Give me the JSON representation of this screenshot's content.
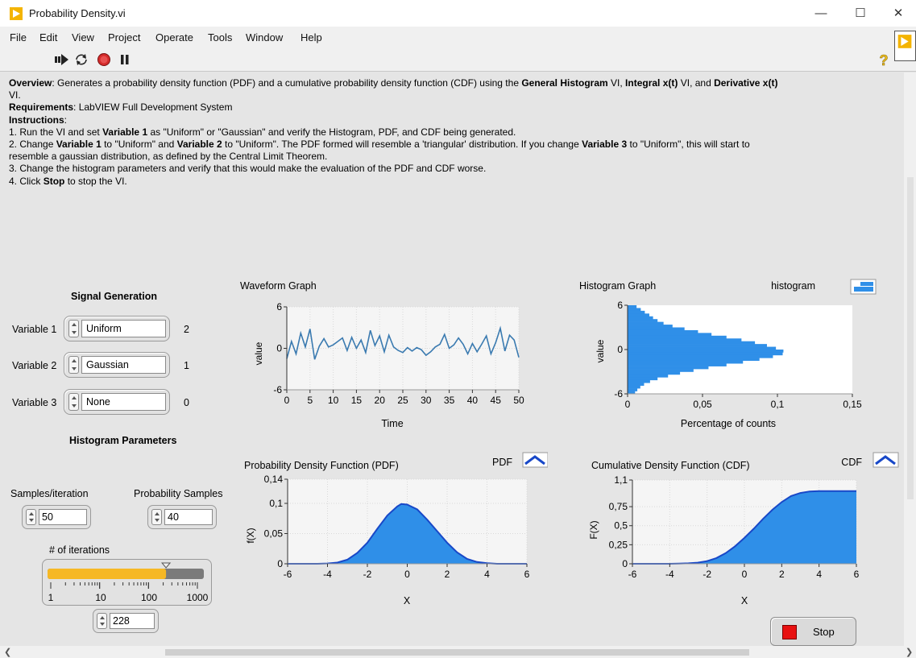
{
  "window": {
    "title": "Probability Density.vi",
    "controls": {
      "minimize": "—",
      "maximize": "☐",
      "close": "✕"
    }
  },
  "menu": [
    "File",
    "Edit",
    "View",
    "Project",
    "Operate",
    "Tools",
    "Window",
    "Help"
  ],
  "toolbar": {
    "icons": [
      "run-arrow-icon",
      "run-continuously-icon",
      "abort-execution-icon",
      "pause-icon"
    ],
    "help_glyph": "?"
  },
  "description": {
    "lines": [
      [
        {
          "t": "Overview",
          "b": true
        },
        {
          "t": ": Generates a probability density function (PDF) and a cumulative probability density function (CDF) using the "
        },
        {
          "t": "General Histogram",
          "b": true
        },
        {
          "t": " VI, "
        },
        {
          "t": "Integral x(t)",
          "b": true
        },
        {
          "t": " VI, and "
        },
        {
          "t": "Derivative x(t)",
          "b": true
        },
        {
          "t": "\nVI."
        }
      ],
      [
        {
          "t": "Requirements",
          "b": true
        },
        {
          "t": ": LabVIEW Full Development System"
        }
      ],
      [
        {
          "t": "Instructions",
          "b": true
        },
        {
          "t": ":"
        }
      ],
      [
        {
          "t": "1. Run the VI and set "
        },
        {
          "t": "Variable 1",
          "b": true
        },
        {
          "t": " as \"Uniform\" or \"Gaussian\" and verify the Histogram, PDF, and CDF being generated."
        }
      ],
      [
        {
          "t": "2. Change "
        },
        {
          "t": "Variable 1",
          "b": true
        },
        {
          "t": " to \"Uniform\" and "
        },
        {
          "t": "Variable 2",
          "b": true
        },
        {
          "t": " to \"Uniform\". The PDF formed will resemble a 'triangular' distribution. If you change "
        },
        {
          "t": "Variable 3",
          "b": true
        },
        {
          "t": " to \"Uniform\", this will start to\nresemble a gaussian distribution, as defined by the Central Limit Theorem."
        }
      ],
      [
        {
          "t": "3. Change the histogram parameters and verify that this would make the evaluation of the PDF and CDF worse."
        }
      ],
      [
        {
          "t": "4. Click "
        },
        {
          "t": "Stop",
          "b": true
        },
        {
          "t": " to stop the VI."
        }
      ]
    ]
  },
  "signal_generation": {
    "title": "Signal Generation",
    "variables": [
      {
        "label": "Variable 1",
        "value": "Uniform",
        "index": "2"
      },
      {
        "label": "Variable 2",
        "value": "Gaussian",
        "index": "1"
      },
      {
        "label": "Variable 3",
        "value": "None",
        "index": "0"
      }
    ]
  },
  "histogram_parameters": {
    "title": "Histogram Parameters",
    "samples_label": "Samples/iteration",
    "samples_value": "50",
    "prob_samples_label": "Probability Samples",
    "prob_samples_value": "40",
    "iterations_label": "# of iterations",
    "iterations_value": "228",
    "slider_ticks": [
      "1",
      "10",
      "100",
      "1000"
    ],
    "slider_fraction_log": 0.786
  },
  "stop_button": {
    "label": "Stop"
  },
  "colors": {
    "plot": "#2f8fe8",
    "plot_line": "#1848c8",
    "trace": "#3a7ab0",
    "slider_fill": "#f6b825",
    "slider_bg": "#7b7b7b"
  },
  "chart_data": [
    {
      "id": "waveform",
      "type": "line",
      "title": "Waveform Graph",
      "xlabel": "Time",
      "ylabel": "value",
      "xlim": [
        0,
        50
      ],
      "ylim": [
        -6,
        6
      ],
      "xticks": [
        "0",
        "5",
        "10",
        "15",
        "20",
        "25",
        "30",
        "35",
        "40",
        "45",
        "50"
      ],
      "yticks": [
        "6",
        "0",
        "-6"
      ],
      "grid": true,
      "y": [
        -1.5,
        1.0,
        -0.8,
        2.2,
        0.2,
        2.8,
        -1.6,
        0.3,
        1.4,
        0.2,
        0.5,
        1.0,
        1.5,
        -0.3,
        1.6,
        0.0,
        1.2,
        -0.6,
        2.6,
        0.4,
        1.8,
        -0.5,
        1.9,
        0.2,
        -0.3,
        -0.6,
        0.1,
        -0.4,
        0.1,
        -0.2,
        -1.0,
        -0.5,
        0.2,
        0.6,
        2.0,
        0.0,
        0.5,
        1.5,
        0.6,
        -0.8,
        0.7,
        -0.5,
        0.6,
        1.8,
        -0.8,
        0.8,
        2.9,
        -0.4,
        1.9,
        1.2,
        -1.3
      ]
    },
    {
      "id": "histogram",
      "type": "bar",
      "title": "Histogram Graph",
      "legend": "histogram",
      "legend_position": "top-right",
      "xlabel": "Percentage of counts",
      "ylabel": "value",
      "xlim": [
        0,
        0.15
      ],
      "ylim": [
        -6,
        6
      ],
      "xticks": [
        "0",
        "0,05",
        "0,1",
        "0,15"
      ],
      "yticks": [
        "6",
        "0",
        "-6"
      ],
      "grid": false,
      "bins_from_top": [
        0.006,
        0.0088,
        0.0115,
        0.0145,
        0.017,
        0.02,
        0.024,
        0.03,
        0.038,
        0.047,
        0.056,
        0.066,
        0.076,
        0.085,
        0.093,
        0.099,
        0.104,
        0.1035,
        0.097,
        0.088,
        0.077,
        0.066,
        0.054,
        0.044,
        0.035,
        0.027,
        0.02,
        0.015,
        0.011,
        0.0085,
        0.0065,
        0.005
      ]
    },
    {
      "id": "pdf",
      "type": "area",
      "title": "Probability Density Function (PDF)",
      "legend": "PDF",
      "legend_position": "top-right",
      "xlabel": "X",
      "ylabel": "f(X)",
      "xlim": [
        -6,
        6
      ],
      "ylim": [
        0,
        0.14
      ],
      "xticks": [
        "-6",
        "-4",
        "-2",
        "0",
        "2",
        "4",
        "6"
      ],
      "yticks": [
        "0,14",
        "0,1",
        "0,05",
        "0"
      ],
      "grid": true,
      "x": [
        -6,
        -5.5,
        -5,
        -4.5,
        -4,
        -3.5,
        -3,
        -2.5,
        -2,
        -1.5,
        -1,
        -0.5,
        -0.3,
        0,
        0.5,
        1,
        1.5,
        2,
        2.5,
        3,
        3.5,
        4,
        4.5,
        5,
        5.5,
        6
      ],
      "y": [
        0,
        0,
        0,
        0,
        0.0005,
        0.002,
        0.007,
        0.018,
        0.035,
        0.058,
        0.08,
        0.095,
        0.099,
        0.098,
        0.09,
        0.073,
        0.054,
        0.035,
        0.019,
        0.008,
        0.003,
        0.001,
        0,
        0,
        0,
        0
      ]
    },
    {
      "id": "cdf",
      "type": "area",
      "title": "Cumulative Density Function (CDF)",
      "legend": "CDF",
      "legend_position": "top-right",
      "xlabel": "X",
      "ylabel": "F(X)",
      "xlim": [
        -6,
        6
      ],
      "ylim": [
        0,
        1.1
      ],
      "xticks": [
        "-6",
        "-4",
        "-2",
        "0",
        "2",
        "4",
        "6"
      ],
      "yticks": [
        "1,1",
        "0,75",
        "0,5",
        "0,25",
        "0"
      ],
      "grid": true,
      "x": [
        -6,
        -5,
        -4,
        -3.5,
        -3,
        -2.5,
        -2,
        -1.5,
        -1,
        -0.5,
        0,
        0.5,
        1,
        1.5,
        2,
        2.5,
        3,
        3.5,
        4,
        5,
        6
      ],
      "y": [
        0,
        0,
        0,
        0.002,
        0.006,
        0.015,
        0.035,
        0.075,
        0.14,
        0.23,
        0.34,
        0.46,
        0.59,
        0.71,
        0.81,
        0.89,
        0.93,
        0.95,
        0.955,
        0.955,
        0.955
      ]
    }
  ]
}
